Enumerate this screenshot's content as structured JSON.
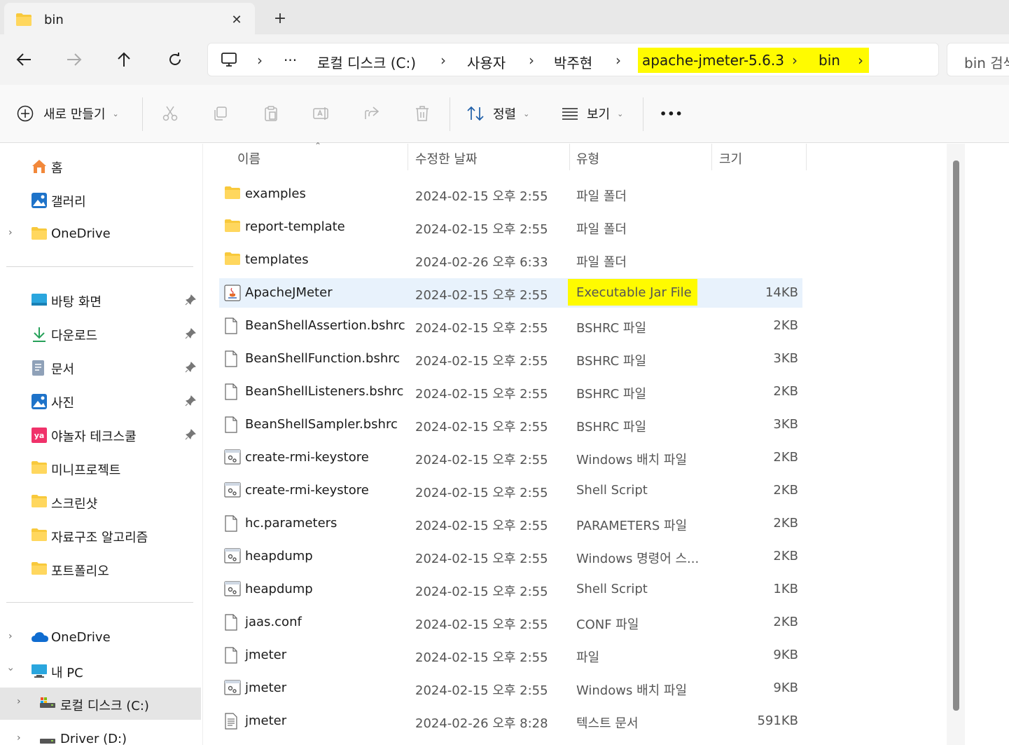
{
  "tab": {
    "title": "bin",
    "close_glyph": "✕",
    "new_tab_glyph": "+"
  },
  "address": {
    "crumbs": [
      "로컬 디스크 (C:)",
      "사용자",
      "박주현",
      "apache-jmeter-5.6.3",
      "bin"
    ],
    "overflow": "···",
    "separator": "›",
    "highlight_color": "#fffb00"
  },
  "search": {
    "placeholder": "bin 검색"
  },
  "toolbar": {
    "new_label": "새로 만들기",
    "sort_label": "정렬",
    "view_label": "보기",
    "more_glyph": "•••"
  },
  "sidebar": {
    "home": "홈",
    "gallery": "갤러리",
    "onedrive_top": "OneDrive",
    "quick": [
      {
        "label": "바탕 화면",
        "icon": "desktop-icon",
        "pinned": true
      },
      {
        "label": "다운로드",
        "icon": "download-icon",
        "pinned": true
      },
      {
        "label": "문서",
        "icon": "documents-icon",
        "pinned": true
      },
      {
        "label": "사진",
        "icon": "pictures-icon",
        "pinned": true
      },
      {
        "label": "야놀자 테크스쿨",
        "icon": "yanolja-icon",
        "pinned": true
      },
      {
        "label": "미니프로젝트",
        "icon": "folder-icon",
        "pinned": false
      },
      {
        "label": "스크린샷",
        "icon": "folder-icon",
        "pinned": false
      },
      {
        "label": "자료구조 알고리즘",
        "icon": "folder-icon",
        "pinned": false
      },
      {
        "label": "포트폴리오",
        "icon": "folder-icon",
        "pinned": false
      }
    ],
    "onedrive": "OneDrive",
    "mypc": "내 PC",
    "local_disk": "로컬 디스크 (C:)",
    "driver": "Driver (D:)",
    "pin_glyph": "📌"
  },
  "columns": {
    "name": "이름",
    "date": "수정한 날짜",
    "type": "유형",
    "size": "크기"
  },
  "files": [
    {
      "name": "examples",
      "date": "2024-02-15 오후 2:55",
      "type": "파일 폴더",
      "size": "",
      "icon": "folder"
    },
    {
      "name": "report-template",
      "date": "2024-02-15 오후 2:55",
      "type": "파일 폴더",
      "size": "",
      "icon": "folder"
    },
    {
      "name": "templates",
      "date": "2024-02-26 오후 6:33",
      "type": "파일 폴더",
      "size": "",
      "icon": "folder"
    },
    {
      "name": "ApacheJMeter",
      "date": "2024-02-15 오후 2:55",
      "type": "Executable Jar File",
      "size": "14KB",
      "icon": "jar",
      "selected": true,
      "highlight": true
    },
    {
      "name": "BeanShellAssertion.bshrc",
      "date": "2024-02-15 오후 2:55",
      "type": "BSHRC 파일",
      "size": "2KB",
      "icon": "file"
    },
    {
      "name": "BeanShellFunction.bshrc",
      "date": "2024-02-15 오후 2:55",
      "type": "BSHRC 파일",
      "size": "3KB",
      "icon": "file"
    },
    {
      "name": "BeanShellListeners.bshrc",
      "date": "2024-02-15 오후 2:55",
      "type": "BSHRC 파일",
      "size": "2KB",
      "icon": "file"
    },
    {
      "name": "BeanShellSampler.bshrc",
      "date": "2024-02-15 오후 2:55",
      "type": "BSHRC 파일",
      "size": "3KB",
      "icon": "file"
    },
    {
      "name": "create-rmi-keystore",
      "date": "2024-02-15 오후 2:55",
      "type": "Windows 배치 파일",
      "size": "2KB",
      "icon": "script"
    },
    {
      "name": "create-rmi-keystore",
      "date": "2024-02-15 오후 2:55",
      "type": "Shell Script",
      "size": "2KB",
      "icon": "script"
    },
    {
      "name": "hc.parameters",
      "date": "2024-02-15 오후 2:55",
      "type": "PARAMETERS 파일",
      "size": "2KB",
      "icon": "file"
    },
    {
      "name": "heapdump",
      "date": "2024-02-15 오후 2:55",
      "type": "Windows 명령어 스...",
      "size": "2KB",
      "icon": "script"
    },
    {
      "name": "heapdump",
      "date": "2024-02-15 오후 2:55",
      "type": "Shell Script",
      "size": "1KB",
      "icon": "script"
    },
    {
      "name": "jaas.conf",
      "date": "2024-02-15 오후 2:55",
      "type": "CONF 파일",
      "size": "2KB",
      "icon": "file"
    },
    {
      "name": "jmeter",
      "date": "2024-02-15 오후 2:55",
      "type": "파일",
      "size": "9KB",
      "icon": "file"
    },
    {
      "name": "jmeter",
      "date": "2024-02-15 오후 2:55",
      "type": "Windows 배치 파일",
      "size": "9KB",
      "icon": "script"
    },
    {
      "name": "jmeter",
      "date": "2024-02-26 오후 8:28",
      "type": "텍스트 문서",
      "size": "591KB",
      "icon": "text"
    }
  ]
}
